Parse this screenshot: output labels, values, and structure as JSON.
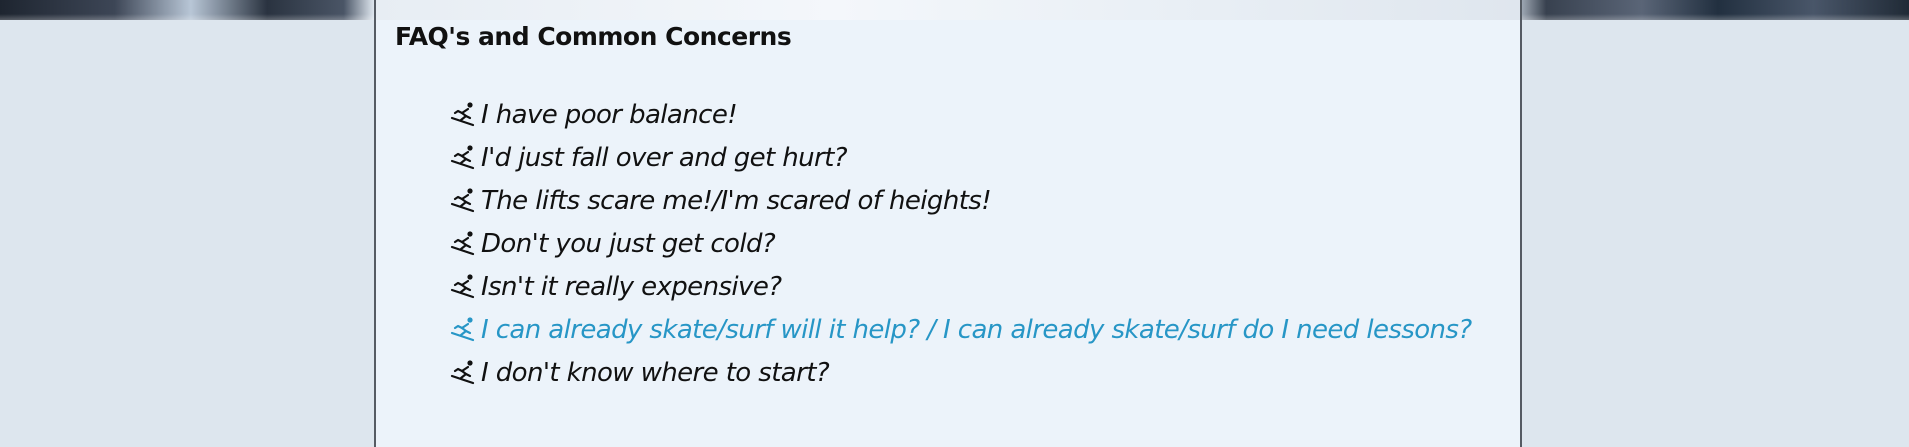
{
  "faq": {
    "heading": "FAQ's and Common Concerns",
    "items": [
      {
        "text": "I have poor balance!",
        "link": false,
        "icon": "skier-icon"
      },
      {
        "text": "I'd just fall over and get hurt?",
        "link": false,
        "icon": "skier-icon"
      },
      {
        "text": "The lifts scare me!/I'm scared of heights!",
        "link": false,
        "icon": "skier-icon"
      },
      {
        "text": "Don't you just get cold?",
        "link": false,
        "icon": "skier-icon"
      },
      {
        "text": "Isn't it really expensive?",
        "link": false,
        "icon": "skier-icon"
      },
      {
        "text": "I can already skate/surf will it help? / I can already skate/surf do I need lessons?",
        "link": true,
        "icon": "skier-icon"
      },
      {
        "text": "I don't know where to start?",
        "link": false,
        "icon": "skier-icon"
      }
    ]
  },
  "colors": {
    "page_background": "#dde6ee",
    "panel_background": "#ecf3fa",
    "panel_border": "#555b63",
    "text": "#111111",
    "link": "#2796c6"
  }
}
